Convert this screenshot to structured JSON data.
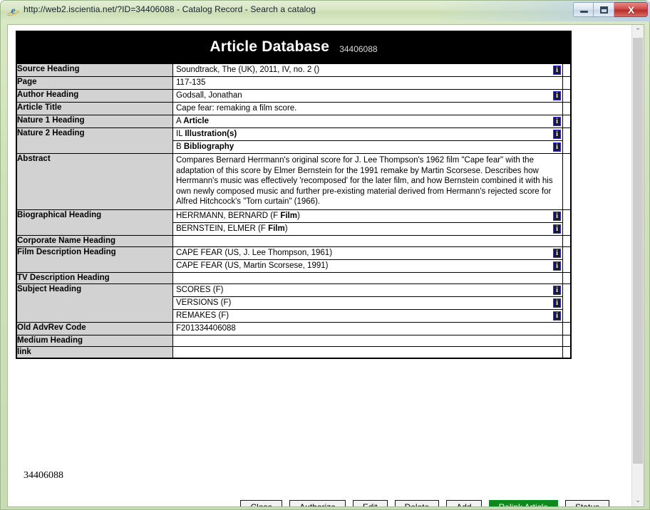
{
  "window": {
    "title": "http://web2.iscientia.net/?ID=34406088 - Catalog Record - Search a catalog",
    "browser_icon": "ie-logo-icon",
    "minimize_label": "",
    "maximize_label": "",
    "close_label": "X"
  },
  "header": {
    "title": "Article Database",
    "record_id": "34406088"
  },
  "record": {
    "footer_id": "34406088",
    "rows": [
      {
        "label": "Source Heading",
        "lines": [
          {
            "text": "Soundtrack, The (UK), 2011, IV, no. 2 ()",
            "info": true
          }
        ]
      },
      {
        "label": "Page",
        "lines": [
          {
            "text": "117-135",
            "info": false
          }
        ]
      },
      {
        "label": "Author Heading",
        "lines": [
          {
            "text": "Godsall, Jonathan",
            "info": true
          }
        ]
      },
      {
        "label": "Article Title",
        "lines": [
          {
            "text": "Cape fear: remaking a film score.",
            "info": false
          }
        ]
      },
      {
        "label": "Nature 1 Heading",
        "lines": [
          {
            "code": "A",
            "bold": "Article",
            "info": true
          }
        ]
      },
      {
        "label": "Nature 2 Heading",
        "lines": [
          {
            "code": "IL",
            "bold": "Illustration(s)",
            "info": true
          },
          {
            "code": "B",
            "bold": "Bibliography",
            "info": true
          }
        ]
      },
      {
        "label": "Abstract",
        "abstract": "Compares Bernard Herrmann's original score for J. Lee Thompson's 1962 film \"Cape fear\" with the adaptation of this score by Elmer Bernstein for the 1991 remake by Martin Scorsese. Describes how Herrmann's music was effectively 'recomposed' for the later film, and how Bernstein combined it with his own newly composed music and further pre-existing material derived from Hermann's rejected score for Alfred Hitchcock's \"Torn curtain\" (1966)."
      },
      {
        "label": "Biographical Heading",
        "lines": [
          {
            "text": "HERRMANN, BERNARD (F ",
            "bold": "Film",
            "suffix": ")",
            "info": true
          },
          {
            "text": "BERNSTEIN, ELMER (F ",
            "bold": "Film",
            "suffix": ")",
            "info": true
          }
        ]
      },
      {
        "label": "Corporate Name Heading",
        "lines": [
          {
            "text": "",
            "info": false
          }
        ]
      },
      {
        "label": "Film Description Heading",
        "lines": [
          {
            "text": "CAPE FEAR (US, J. Lee Thompson, 1961)",
            "info": true
          },
          {
            "text": "CAPE FEAR (US, Martin Scorsese, 1991)",
            "info": true
          }
        ]
      },
      {
        "label": "TV Description Heading",
        "lines": [
          {
            "text": "",
            "info": false
          }
        ]
      },
      {
        "label": "Subject Heading",
        "lines": [
          {
            "text": "SCORES (F)",
            "info": true
          },
          {
            "text": "VERSIONS (F)",
            "info": true
          },
          {
            "text": "REMAKES (F)",
            "info": true
          }
        ]
      },
      {
        "label": "Old AdvRev Code",
        "lines": [
          {
            "text": "F201334406088",
            "info": false
          }
        ]
      },
      {
        "label": "Medium Heading",
        "lines": [
          {
            "text": "",
            "info": false
          }
        ]
      },
      {
        "label": "link",
        "lines": [
          {
            "text": "",
            "info": false
          }
        ]
      }
    ]
  },
  "buttons": [
    {
      "label": "Close",
      "primary": false
    },
    {
      "label": "Authorize",
      "primary": false
    },
    {
      "label": "Edit",
      "primary": false
    },
    {
      "label": "Delete",
      "primary": false
    },
    {
      "label": "Add",
      "primary": false
    },
    {
      "label": "Relink Article",
      "primary": true
    },
    {
      "label": "Status",
      "primary": false
    }
  ],
  "colors": {
    "header_background": "#000000",
    "label_background": "#d2d2d2",
    "primary_button": "#0c8a1c",
    "info_icon_border": "#3333cc",
    "titlebar": "#d6e6c3"
  },
  "scrollbar": {
    "up_arrow": "⌃",
    "down_arrow": "⌄"
  }
}
